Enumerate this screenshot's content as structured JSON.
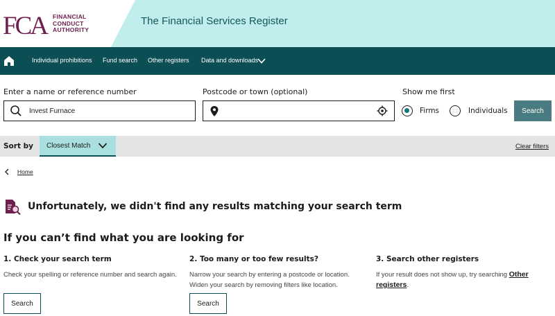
{
  "header": {
    "logo_letters": "FCA",
    "logo_lines": [
      "FINANCIAL",
      "CONDUCT",
      "AUTHORITY"
    ],
    "title": "The Financial Services Register"
  },
  "nav": {
    "home_icon": "home-icon",
    "items": [
      "Individual prohibitions",
      "Fund search",
      "Other registers",
      "Data and downloads"
    ]
  },
  "search": {
    "name_label": "Enter a name or reference number",
    "name_value": "Invest Furnace",
    "postcode_label": "Postcode or town (optional)",
    "postcode_value": "",
    "show_label": "Show me first",
    "options": [
      "Firms",
      "Individuals"
    ],
    "selected": "Firms",
    "button": "Search"
  },
  "sort": {
    "label": "Sort by",
    "value": "Closest Match",
    "clear": "Clear filters"
  },
  "breadcrumb": {
    "home": "Home"
  },
  "results": {
    "message": "Unfortunately, we didn't find any results matching your search term",
    "help_heading": "If you can’t find what you are looking for"
  },
  "help": {
    "col1": {
      "title": "1. Check your search term",
      "text": "Check your spelling or reference number and search again.",
      "button": "Search"
    },
    "col2": {
      "title": "2. Too many or too few results?",
      "text": "Narrow your search by entering a postcode or location. Widen your search by removing filters like location.",
      "button": "Search"
    },
    "col3": {
      "title": "3. Search other registers",
      "text": "If your result does not show up, try searching ",
      "link": "Other registers",
      "after": "."
    }
  },
  "colors": {
    "nav_bg": "#0b4f55",
    "header_bg": "#bfeeec",
    "brand": "#6d1f4d",
    "button_bg": "#497c80",
    "sort_select_bg": "#a9dfdc"
  }
}
